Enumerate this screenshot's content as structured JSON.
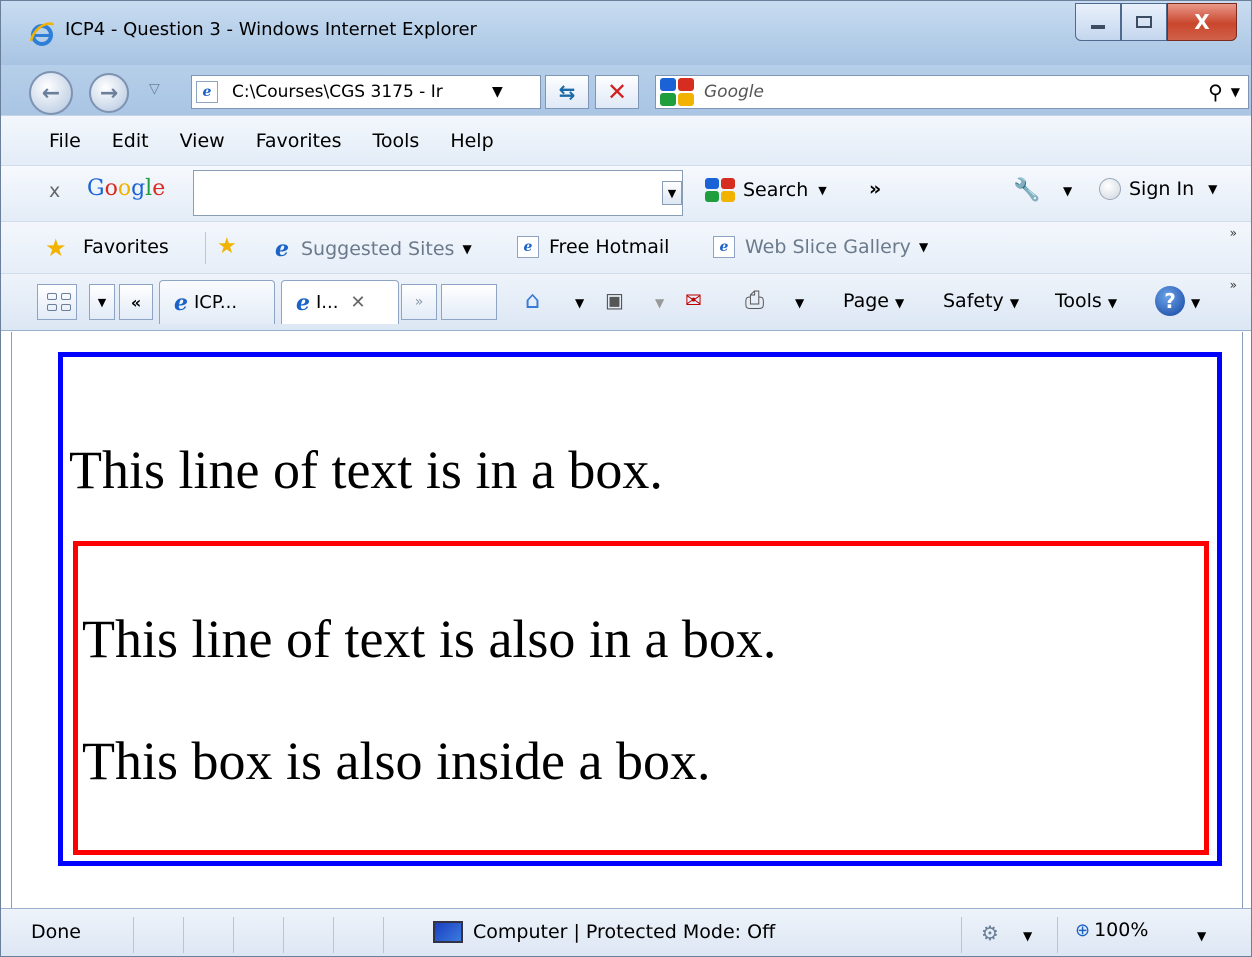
{
  "window": {
    "title": "ICP4 - Question 3 - Windows Internet Explorer",
    "close_glyph": "X"
  },
  "navbar": {
    "address": "C:\\Courses\\CGS 3175 - Ir",
    "search_placeholder": "Google",
    "refresh_icon": "refresh-icon",
    "stop_icon": "stop-icon"
  },
  "menu": {
    "items": [
      "File",
      "Edit",
      "View",
      "Favorites",
      "Tools",
      "Help"
    ]
  },
  "google_toolbar": {
    "close_glyph": "x",
    "logo": "Google",
    "search_label": "Search",
    "more_glyph": "»",
    "sign_in_label": "Sign In"
  },
  "favorites_bar": {
    "favorites_label": "Favorites",
    "items": [
      "Suggested Sites",
      "Free Hotmail",
      "Web Slice Gallery"
    ]
  },
  "tab_bar": {
    "nav_glyph": "«",
    "tabs": [
      {
        "label": "ICP...",
        "active": false
      },
      {
        "label": "I...",
        "active": true
      }
    ],
    "overflow_glyph": "»",
    "commands": [
      "Page",
      "Safety",
      "Tools"
    ]
  },
  "content": {
    "outer_text": "This line of text is in a box.",
    "inner_text_1": "This line of text is also in a box.",
    "inner_text_2": "This box is also inside a box.",
    "outer_border_color": "#0000ff",
    "inner_border_color": "#ff0000"
  },
  "status_bar": {
    "status": "Done",
    "zone": "Computer | Protected Mode: Off",
    "zoom": "100%"
  },
  "colors": {
    "google_blue": "#1a62d6",
    "google_red": "#d62d20",
    "google_yellow": "#f2b300",
    "google_green": "#1e9e3c"
  }
}
